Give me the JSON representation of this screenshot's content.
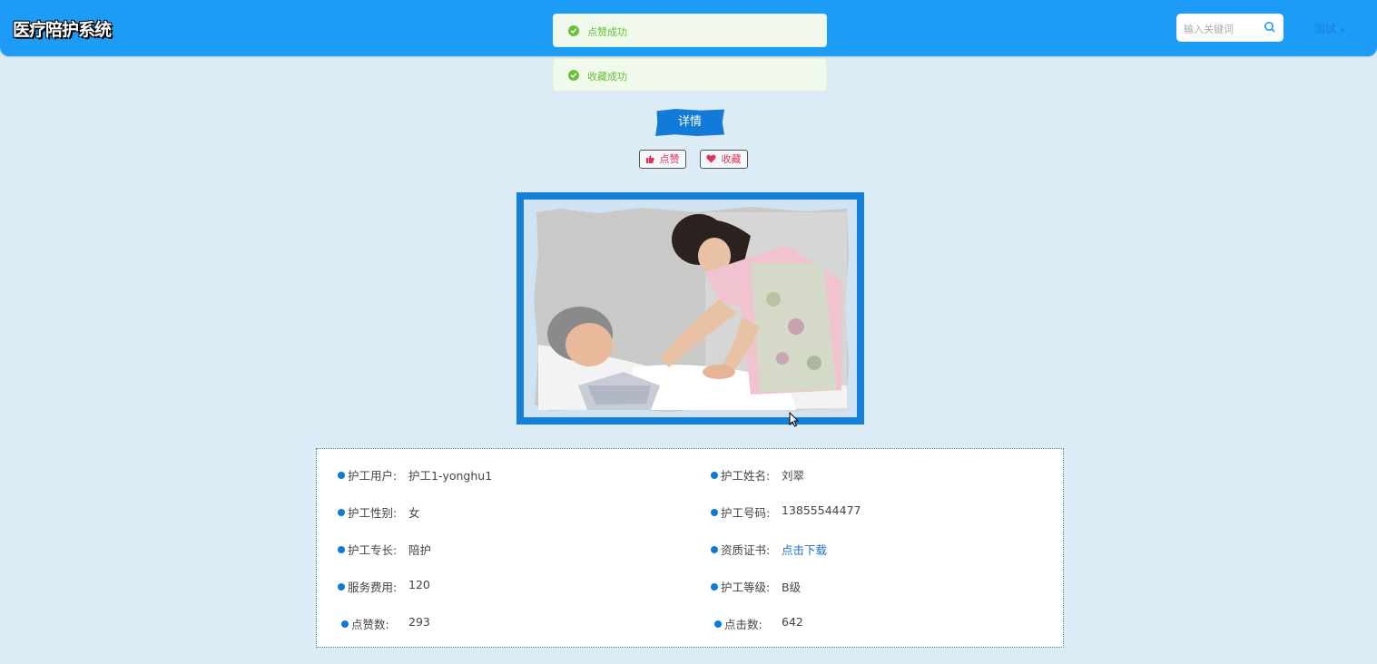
{
  "header": {
    "brand": "医疗陪护系统",
    "search_placeholder": "输入关键词",
    "user_name": "测试",
    "caret": "▾"
  },
  "toasts": [
    {
      "message": "点赞成功"
    },
    {
      "message": "收藏成功"
    }
  ],
  "actions": {
    "detail_label": "详情",
    "like_label": "点赞",
    "favorite_label": "收藏"
  },
  "photo": {
    "description_icon": "nurse-caring-elderly-photo"
  },
  "info": {
    "left": [
      {
        "label": "护工用户:",
        "value": "护工1-yonghu1"
      },
      {
        "label": "护工性别:",
        "value": "女"
      },
      {
        "label": "护工专长:",
        "value": "陪护"
      },
      {
        "label": "服务费用:",
        "value": "120"
      },
      {
        "label": "点赞数:",
        "value": "293"
      }
    ],
    "right": [
      {
        "label": "护工姓名:",
        "value": "刘翠"
      },
      {
        "label": "护工号码:",
        "value": "13855544477"
      },
      {
        "label": "资质证书:",
        "value": "点击下载"
      },
      {
        "label": "护工等级:",
        "value": "B级"
      },
      {
        "label": "点击数:",
        "value": "642"
      }
    ]
  },
  "colors": {
    "header_bg": "#1c9cf6",
    "page_bg": "#dcecf7",
    "accent": "#1680d9",
    "success": "#67c23a",
    "like_pink": "#e0325a"
  }
}
